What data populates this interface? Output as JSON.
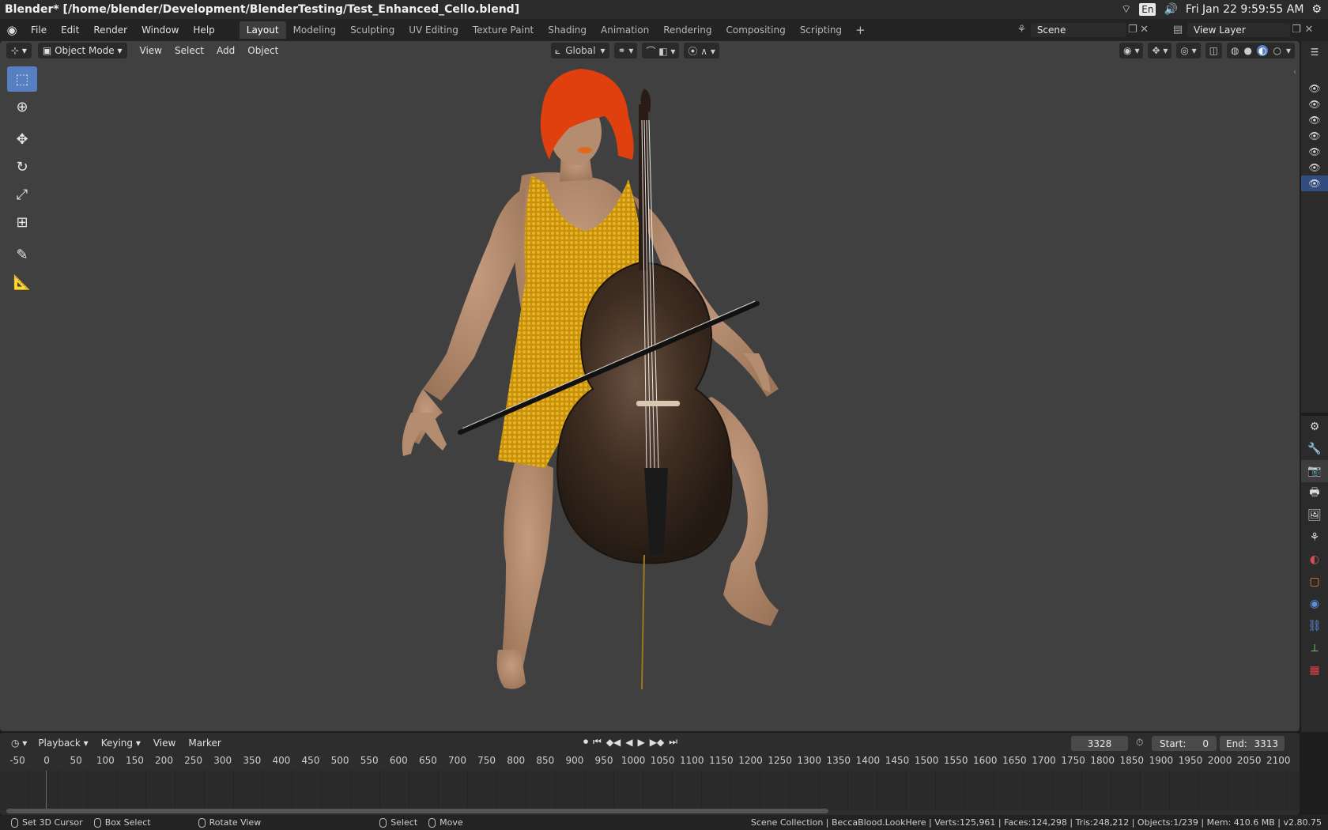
{
  "os": {
    "title": "Blender* [/home/blender/Development/BlenderTesting/Test_Enhanced_Cello.blend]",
    "lang": "En",
    "clock": "Fri Jan 22  9:59:55 AM"
  },
  "menu": {
    "items": [
      "File",
      "Edit",
      "Render",
      "Window",
      "Help"
    ]
  },
  "workspaces": {
    "tabs": [
      "Layout",
      "Modeling",
      "Sculpting",
      "UV Editing",
      "Texture Paint",
      "Shading",
      "Animation",
      "Rendering",
      "Compositing",
      "Scripting"
    ],
    "active": "Layout"
  },
  "scene": {
    "name": "Scene"
  },
  "view_layer": {
    "name": "View Layer"
  },
  "viewport": {
    "mode": "Object Mode",
    "menus": [
      "View",
      "Select",
      "Add",
      "Object"
    ],
    "orientation": "Global"
  },
  "timeline": {
    "menus": [
      "Playback",
      "Keying",
      "View",
      "Marker"
    ],
    "current_frame": "3328",
    "start_label": "Start:",
    "start_value": "0",
    "end_label": "End:",
    "end_value": "3313",
    "ruler": [
      "-50",
      "0",
      "50",
      "100",
      "150",
      "200",
      "250",
      "300",
      "350",
      "400",
      "450",
      "500",
      "550",
      "600",
      "650",
      "700",
      "750",
      "800",
      "850",
      "900",
      "950",
      "1000",
      "1050",
      "1100",
      "1150",
      "1200",
      "1250",
      "1300",
      "1350",
      "1400",
      "1450",
      "1500",
      "1550",
      "1600",
      "1650",
      "1700",
      "1750",
      "1800",
      "1850",
      "1900",
      "1950",
      "2000",
      "2050",
      "2100"
    ]
  },
  "status": {
    "hint1": "Set 3D Cursor",
    "hint2": "Box Select",
    "hint3": "Rotate View",
    "hint4": "Select",
    "hint5": "Move",
    "stats": "Scene Collection | BeccaBlood.LookHere | Verts:125,961 | Faces:124,298 | Tris:248,212 | Objects:1/239 | Mem: 410.6 MB | v2.80.75"
  },
  "colors": {
    "active_tool": "#5680c2",
    "viewport_bg": "#404040",
    "hair": "#e8400f",
    "dress": "#d9a216",
    "cello": "#3b2a1e",
    "skin": "#b08a6e"
  }
}
